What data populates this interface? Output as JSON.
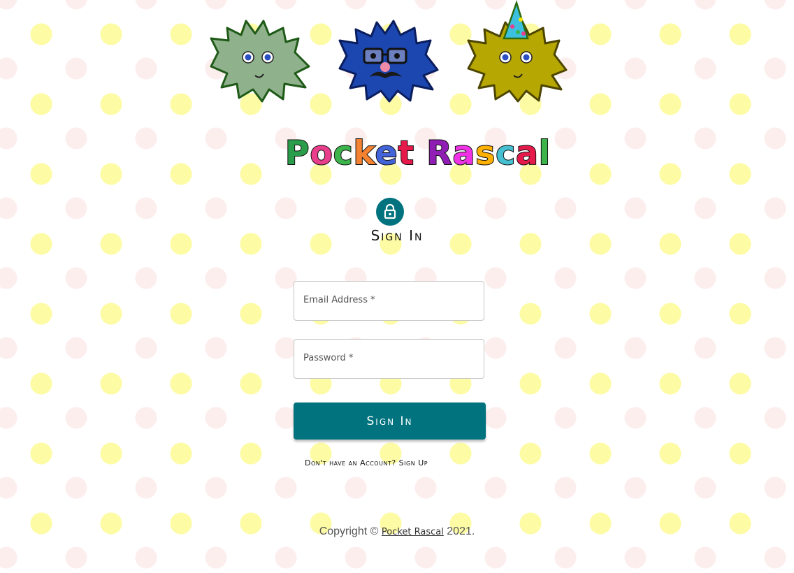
{
  "mascots": [
    {
      "name": "green-monster",
      "color": "#8fb18c",
      "outline": "#1f5a18"
    },
    {
      "name": "blue-monster-glasses",
      "color": "#1c46b0",
      "outline": "#0a1e5e"
    },
    {
      "name": "yellow-monster-party-hat",
      "color": "#b7a702",
      "outline": "#4c4500"
    }
  ],
  "logo": {
    "text": "Pocket Rascal",
    "letters": [
      {
        "char": "P",
        "color": "#2a9d4a"
      },
      {
        "char": "o",
        "color": "#e83e8c"
      },
      {
        "char": "c",
        "color": "#3cb44b"
      },
      {
        "char": "k",
        "color": "#f58231"
      },
      {
        "char": "e",
        "color": "#4363d8"
      },
      {
        "char": "t",
        "color": "#e6194b"
      },
      {
        "char": " ",
        "color": "#000000"
      },
      {
        "char": "R",
        "color": "#911eb4"
      },
      {
        "char": "a",
        "color": "#f032e6"
      },
      {
        "char": "s",
        "color": "#ffb000"
      },
      {
        "char": "c",
        "color": "#46c0d0"
      },
      {
        "char": "a",
        "color": "#e6194b"
      },
      {
        "char": "l",
        "color": "#3cb44b"
      }
    ]
  },
  "form": {
    "lock_icon": "lock-icon",
    "title": "Sign In",
    "email_label": "Email Address *",
    "password_label": "Password *",
    "submit_label": "Sign In",
    "signup_link": "Don't have an Account? Sign Up"
  },
  "footer": {
    "prefix": "Copyright © ",
    "link_text": "Pocket Rascal",
    "suffix": " 2021."
  },
  "colors": {
    "accent": "#00737e",
    "dot_yellow": "#fdfba4",
    "dot_pink": "#fdeeee"
  }
}
